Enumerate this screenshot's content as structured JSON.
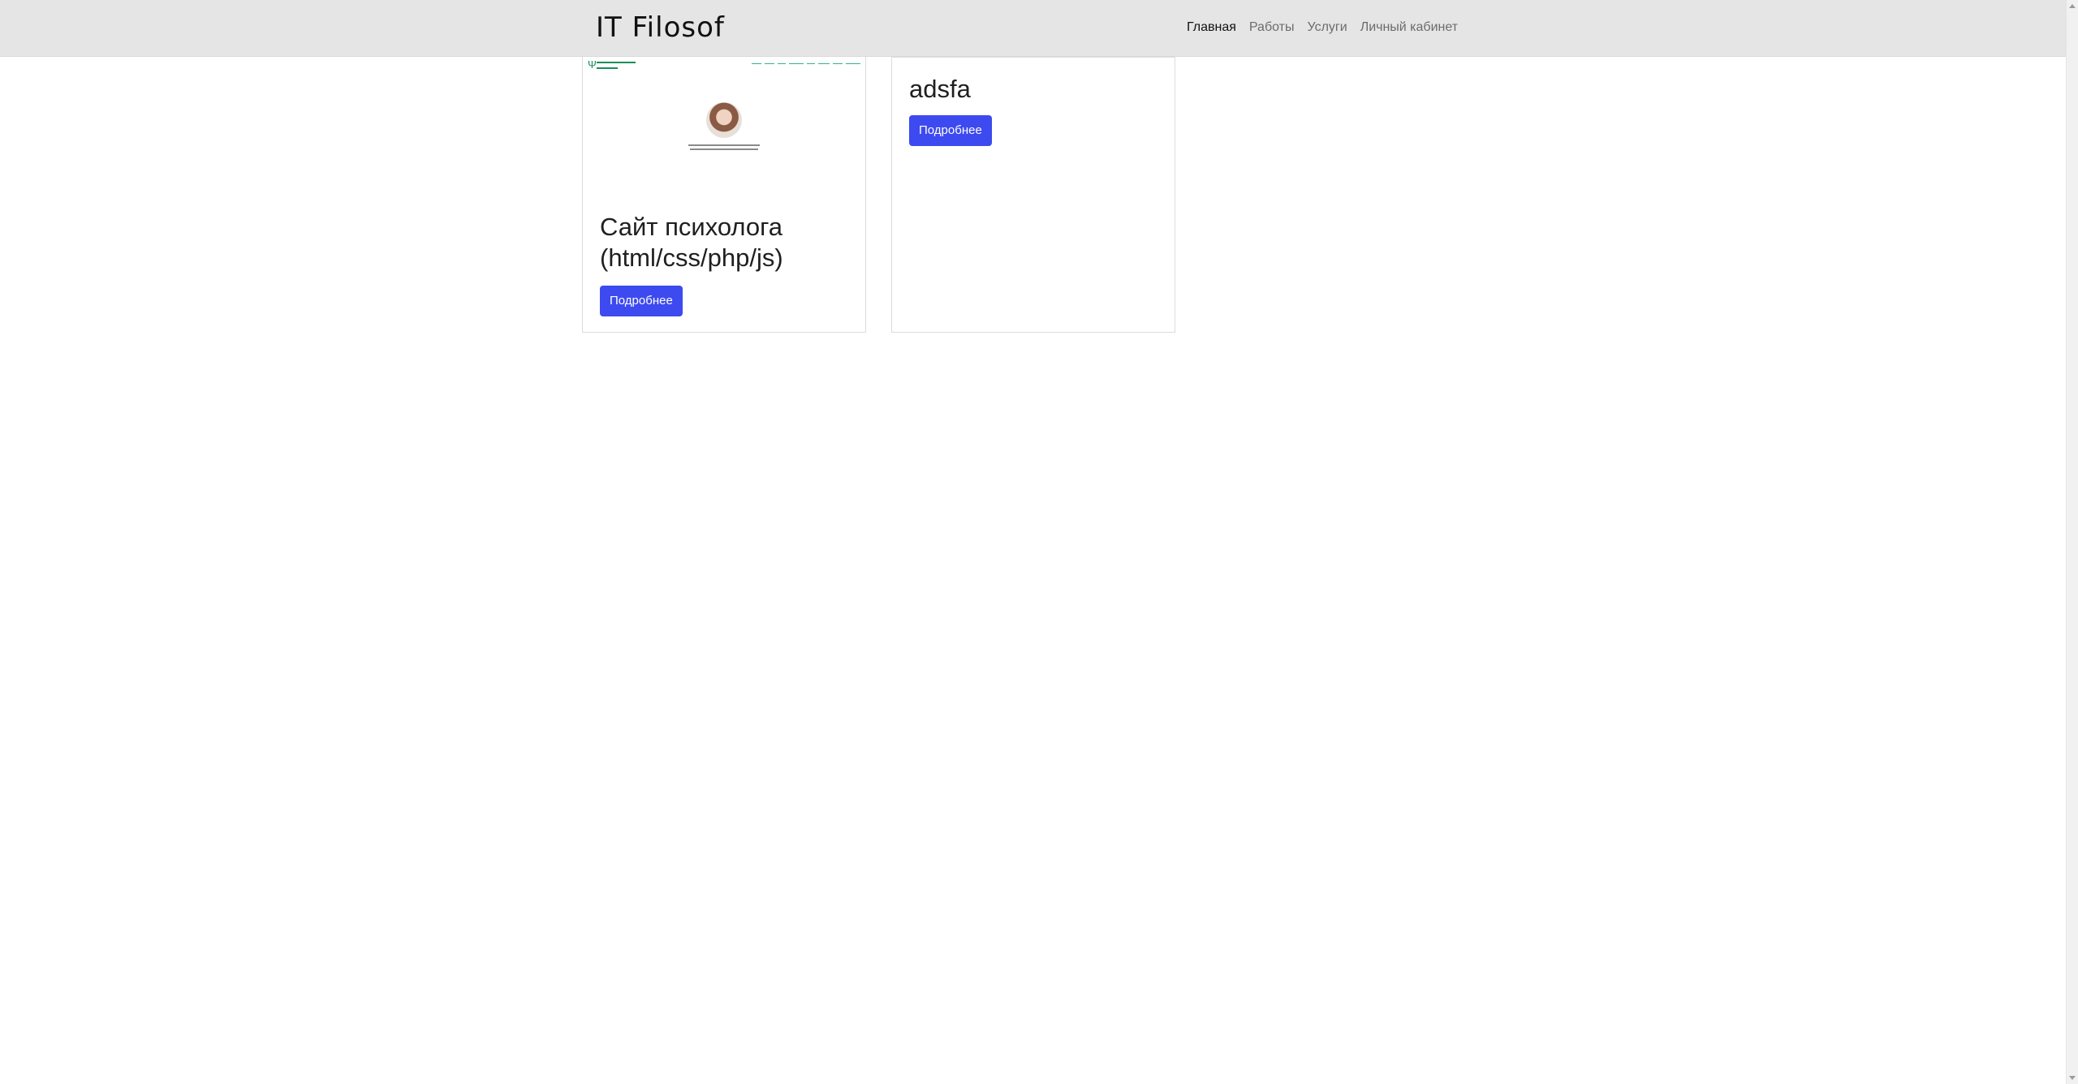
{
  "navbar": {
    "brand": "IT Filosof",
    "links": [
      {
        "label": "Главная",
        "active": true
      },
      {
        "label": "Работы",
        "active": false
      },
      {
        "label": "Услуги",
        "active": false
      },
      {
        "label": "Личный кабинет",
        "active": false
      }
    ]
  },
  "cards": [
    {
      "title": "Сайт психолога (html/css/php/js)",
      "button_label": "Подробнее",
      "has_image": true
    },
    {
      "title": "adsfa",
      "button_label": "Подробнее",
      "has_image": false
    }
  ],
  "colors": {
    "navbar_bg": "#e5e5e5",
    "button_bg": "#3d4af0",
    "preview_accent": "#1a8f5a"
  }
}
